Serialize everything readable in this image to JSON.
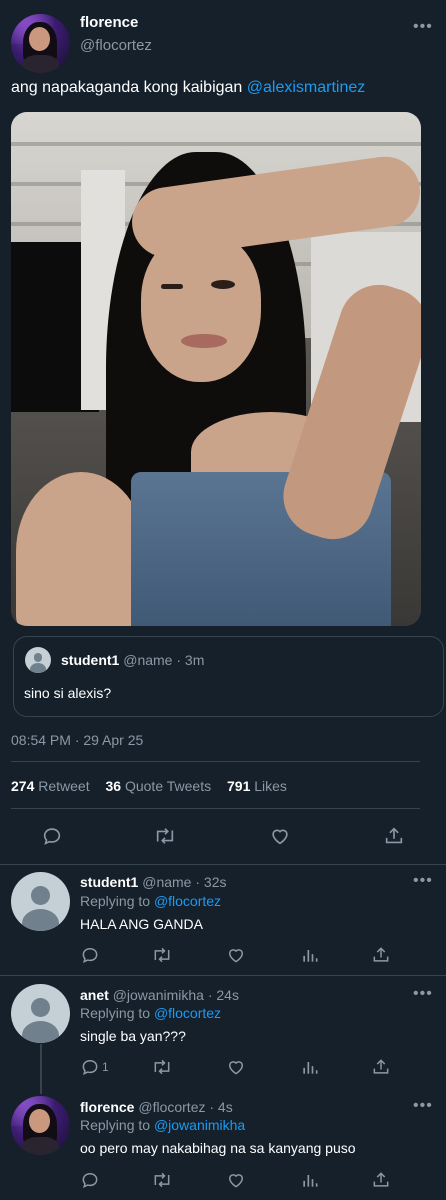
{
  "tweet": {
    "display_name": "florence",
    "handle": "@flocortez",
    "text_plain": "ang napakaganda kong kaibigan ",
    "mention": "@alexismartinez",
    "more_icon": "more-horizontal-icon",
    "timestamp": "08:54 PM · 29 Apr 25",
    "stats": {
      "retweets_count": "274",
      "retweets_label": "Retweet",
      "quotes_count": "36",
      "quotes_label": "Quote Tweets",
      "likes_count": "791",
      "likes_label": "Likes"
    },
    "quoted": {
      "display_name": "student1",
      "handle": "@name",
      "time": "· 3m",
      "text": "sino si alexis?"
    }
  },
  "replies": [
    {
      "display_name": "student1",
      "handle": "@name",
      "time": "· 32s",
      "replying_prefix": "Replying to ",
      "replying_to": "@flocortez",
      "text": "HALA ANG GANDA",
      "reply_count": ""
    },
    {
      "display_name": "anet",
      "handle": "@jowanimikha",
      "time": "· 24s",
      "replying_prefix": "Replying to ",
      "replying_to": "@flocortez",
      "text": "single ba yan???",
      "reply_count": "1"
    },
    {
      "display_name": "florence",
      "handle": "@flocortez",
      "time": "· 4s",
      "replying_prefix": "Replying to ",
      "replying_to": "@jowanimikha",
      "text": "oo pero may nakabihag na sa kanyang puso",
      "reply_count": ""
    }
  ],
  "colors": {
    "background": "#15202b",
    "accent": "#1d9bf0",
    "muted": "#8b98a5",
    "border": "#38444d"
  },
  "icons": [
    "reply-icon",
    "retweet-icon",
    "like-icon",
    "analytics-icon",
    "share-icon",
    "more-horizontal-icon"
  ]
}
